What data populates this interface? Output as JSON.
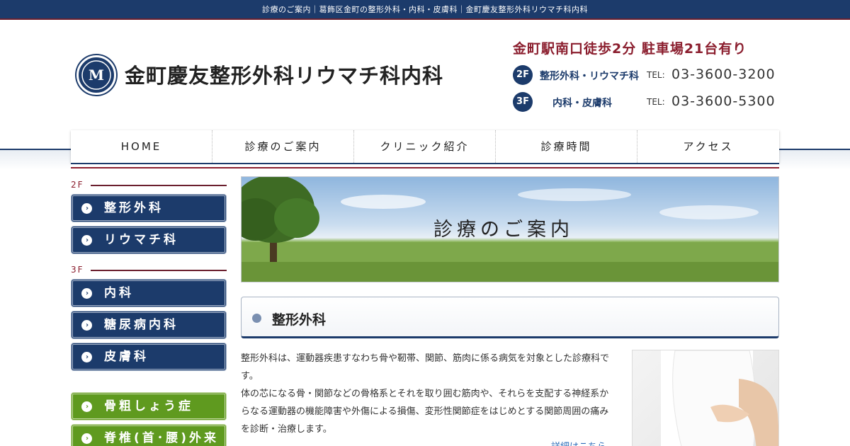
{
  "topbar": {
    "text": "診療のご案内｜葛飾区金町の整形外科・内科・皮膚科｜金町慶友整形外科リウマチ科内科"
  },
  "header": {
    "clinic_name": "金町慶友整形外科リウマチ科内科",
    "access": "金町駅南口徒歩2分 駐車場21台有り",
    "floors": [
      {
        "floor": "2F",
        "dept": "整形外科・リウマチ科",
        "tel_label": "TEL:",
        "tel": "03-3600-3200"
      },
      {
        "floor": "3F",
        "dept": "内科・皮膚科",
        "tel_label": "TEL:",
        "tel": "03-3600-5300"
      }
    ]
  },
  "nav": {
    "items": [
      "HOME",
      "診療のご案内",
      "クリニック紹介",
      "診療時間",
      "アクセス"
    ]
  },
  "sidebar": {
    "floor2_label": "2F",
    "floor2_items": [
      "整形外科",
      "リウマチ科"
    ],
    "floor3_label": "3F",
    "floor3_items": [
      "内科",
      "糖尿病内科",
      "皮膚科"
    ],
    "special_items": [
      "骨粗しょう症",
      "脊椎(首･腰)外来"
    ]
  },
  "hero": {
    "title": "診療のご案内"
  },
  "section": {
    "title": "整形外科",
    "paragraphs": [
      "整形外科は、運動器疾患すなわち骨や靭帯、関節、筋肉に係る病気を対象とした診療科です。",
      "体の芯になる骨・関節などの骨格系とそれを取り囲む筋肉や、それらを支配する神経系からなる運動器の機能障害や外傷による損傷、変形性関節症をはじめとする関節周囲の痛みを診断・治療します。"
    ],
    "more_link": "詳細はこちら"
  },
  "colors": {
    "navy": "#1c3b6b",
    "maroon": "#8b1e2e",
    "green": "#5f9a1f"
  }
}
